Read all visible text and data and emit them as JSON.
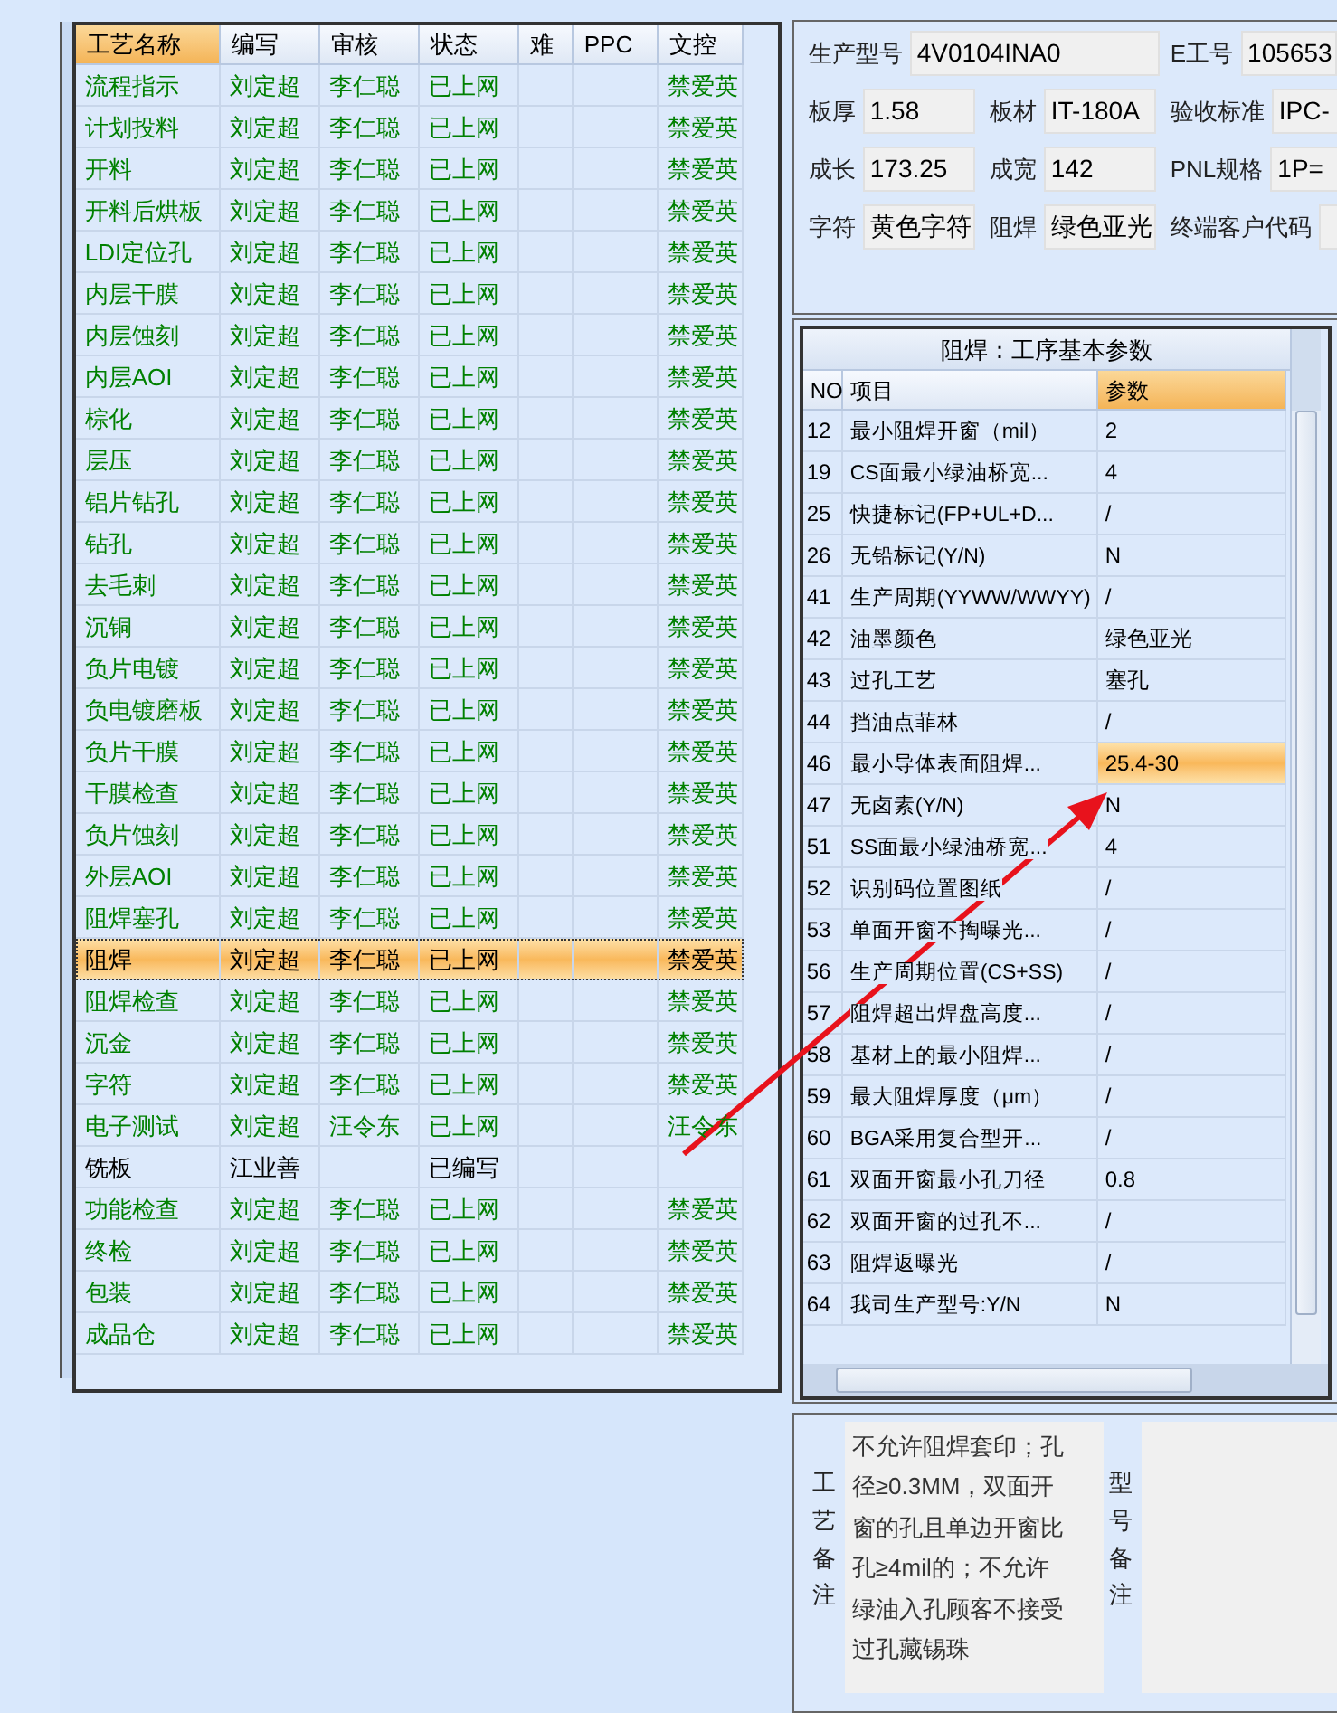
{
  "process_grid": {
    "columns": [
      {
        "label": "工艺名称",
        "sorted": true
      },
      {
        "label": "编写",
        "sorted": false
      },
      {
        "label": "审核",
        "sorted": false
      },
      {
        "label": "状态",
        "sorted": false
      },
      {
        "label": "难",
        "sorted": false
      },
      {
        "label": "PPC",
        "sorted": false
      },
      {
        "label": "文控",
        "sorted": false
      }
    ],
    "rows": [
      {
        "name": "流程指示",
        "writer": "刘定超",
        "reviewer": "李仁聪",
        "status": "已上网",
        "control": "禁爱英",
        "color": "#008000",
        "selected": false
      },
      {
        "name": "计划投料",
        "writer": "刘定超",
        "reviewer": "李仁聪",
        "status": "已上网",
        "control": "禁爱英",
        "color": "#008000",
        "selected": false
      },
      {
        "name": "开料",
        "writer": "刘定超",
        "reviewer": "李仁聪",
        "status": "已上网",
        "control": "禁爱英",
        "color": "#008000",
        "selected": false
      },
      {
        "name": "开料后烘板",
        "writer": "刘定超",
        "reviewer": "李仁聪",
        "status": "已上网",
        "control": "禁爱英",
        "color": "#008000",
        "selected": false
      },
      {
        "name": "LDI定位孔",
        "writer": "刘定超",
        "reviewer": "李仁聪",
        "status": "已上网",
        "control": "禁爱英",
        "color": "#008000",
        "selected": false
      },
      {
        "name": "内层干膜",
        "writer": "刘定超",
        "reviewer": "李仁聪",
        "status": "已上网",
        "control": "禁爱英",
        "color": "#008000",
        "selected": false
      },
      {
        "name": "内层蚀刻",
        "writer": "刘定超",
        "reviewer": "李仁聪",
        "status": "已上网",
        "control": "禁爱英",
        "color": "#008000",
        "selected": false
      },
      {
        "name": "内层AOI",
        "writer": "刘定超",
        "reviewer": "李仁聪",
        "status": "已上网",
        "control": "禁爱英",
        "color": "#008000",
        "selected": false
      },
      {
        "name": "棕化",
        "writer": "刘定超",
        "reviewer": "李仁聪",
        "status": "已上网",
        "control": "禁爱英",
        "color": "#008000",
        "selected": false
      },
      {
        "name": "层压",
        "writer": "刘定超",
        "reviewer": "李仁聪",
        "status": "已上网",
        "control": "禁爱英",
        "color": "#008000",
        "selected": false
      },
      {
        "name": "铝片钻孔",
        "writer": "刘定超",
        "reviewer": "李仁聪",
        "status": "已上网",
        "control": "禁爱英",
        "color": "#008000",
        "selected": false
      },
      {
        "name": "钻孔",
        "writer": "刘定超",
        "reviewer": "李仁聪",
        "status": "已上网",
        "control": "禁爱英",
        "color": "#008000",
        "selected": false
      },
      {
        "name": "去毛刺",
        "writer": "刘定超",
        "reviewer": "李仁聪",
        "status": "已上网",
        "control": "禁爱英",
        "color": "#008000",
        "selected": false
      },
      {
        "name": "沉铜",
        "writer": "刘定超",
        "reviewer": "李仁聪",
        "status": "已上网",
        "control": "禁爱英",
        "color": "#008000",
        "selected": false
      },
      {
        "name": "负片电镀",
        "writer": "刘定超",
        "reviewer": "李仁聪",
        "status": "已上网",
        "control": "禁爱英",
        "color": "#008000",
        "selected": false
      },
      {
        "name": "负电镀磨板",
        "writer": "刘定超",
        "reviewer": "李仁聪",
        "status": "已上网",
        "control": "禁爱英",
        "color": "#008000",
        "selected": false
      },
      {
        "name": "负片干膜",
        "writer": "刘定超",
        "reviewer": "李仁聪",
        "status": "已上网",
        "control": "禁爱英",
        "color": "#008000",
        "selected": false
      },
      {
        "name": "干膜检查",
        "writer": "刘定超",
        "reviewer": "李仁聪",
        "status": "已上网",
        "control": "禁爱英",
        "color": "#008000",
        "selected": false
      },
      {
        "name": "负片蚀刻",
        "writer": "刘定超",
        "reviewer": "李仁聪",
        "status": "已上网",
        "control": "禁爱英",
        "color": "#008000",
        "selected": false
      },
      {
        "name": "外层AOI",
        "writer": "刘定超",
        "reviewer": "李仁聪",
        "status": "已上网",
        "control": "禁爱英",
        "color": "#008000",
        "selected": false
      },
      {
        "name": "阻焊塞孔",
        "writer": "刘定超",
        "reviewer": "李仁聪",
        "status": "已上网",
        "control": "禁爱英",
        "color": "#008000",
        "selected": false
      },
      {
        "name": "阻焊",
        "writer": "刘定超",
        "reviewer": "李仁聪",
        "status": "已上网",
        "control": "禁爱英",
        "color": "#000000",
        "selected": true
      },
      {
        "name": "阻焊检查",
        "writer": "刘定超",
        "reviewer": "李仁聪",
        "status": "已上网",
        "control": "禁爱英",
        "color": "#008000",
        "selected": false
      },
      {
        "name": "沉金",
        "writer": "刘定超",
        "reviewer": "李仁聪",
        "status": "已上网",
        "control": "禁爱英",
        "color": "#008000",
        "selected": false
      },
      {
        "name": "字符",
        "writer": "刘定超",
        "reviewer": "李仁聪",
        "status": "已上网",
        "control": "禁爱英",
        "color": "#008000",
        "selected": false
      },
      {
        "name": "电子测试",
        "writer": "刘定超",
        "reviewer": "汪令东",
        "status": "已上网",
        "control": "汪令东",
        "color": "#008000",
        "selected": false
      },
      {
        "name": "铣板",
        "writer": "江业善",
        "status": "已编写",
        "color": "#000000",
        "selected": false
      },
      {
        "name": "功能检查",
        "writer": "刘定超",
        "reviewer": "李仁聪",
        "status": "已上网",
        "control": "禁爱英",
        "color": "#008000",
        "selected": false
      },
      {
        "name": "终检",
        "writer": "刘定超",
        "reviewer": "李仁聪",
        "status": "已上网",
        "control": "禁爱英",
        "color": "#008000",
        "selected": false
      },
      {
        "name": "包装",
        "writer": "刘定超",
        "reviewer": "李仁聪",
        "status": "已上网",
        "control": "禁爱英",
        "color": "#008000",
        "selected": false
      },
      {
        "name": "成品仓",
        "writer": "刘定超",
        "reviewer": "李仁聪",
        "status": "已上网",
        "control": "禁爱英",
        "color": "#008000",
        "selected": false
      }
    ]
  },
  "info": {
    "fields": [
      {
        "label": "生产型号",
        "value": "4V0104INA0"
      },
      {
        "label": "E工号",
        "value": "105653"
      },
      {
        "label": "板厚",
        "value": "1.58"
      },
      {
        "label": "板材",
        "value": "IT-180A"
      },
      {
        "label": "验收标准",
        "value": "IPC-"
      },
      {
        "label": "成长",
        "value": "173.25"
      },
      {
        "label": "成宽",
        "value": "142"
      },
      {
        "label": "PNL规格",
        "value": "1P="
      },
      {
        "label": "字符",
        "value": "黄色字符"
      },
      {
        "label": "阻焊",
        "value": "绿色亚光"
      },
      {
        "label": "终端客户代码"
      }
    ]
  },
  "params": {
    "title": "阻焊：工序基本参数",
    "columns": [
      {
        "label": "NO",
        "sorted": false
      },
      {
        "label": "项目",
        "sorted": false
      },
      {
        "label": "参数",
        "sorted": true
      }
    ],
    "rows": [
      {
        "no": "12",
        "item": "最小阻焊开窗（mil）",
        "value": "2",
        "selected": false
      },
      {
        "no": "19",
        "item": "CS面最小绿油桥宽...",
        "value": "4",
        "selected": false
      },
      {
        "no": "25",
        "item": "快捷标记(FP+UL+D...",
        "value": "/",
        "selected": false
      },
      {
        "no": "26",
        "item": "无铅标记(Y/N)",
        "value": "N",
        "selected": false
      },
      {
        "no": "41",
        "item": "生产周期(YYWW/WWYY)",
        "value": "/",
        "selected": false
      },
      {
        "no": "42",
        "item": "油墨颜色",
        "value": "绿色亚光",
        "selected": false
      },
      {
        "no": "43",
        "item": "过孔工艺",
        "value": "塞孔",
        "selected": false
      },
      {
        "no": "44",
        "item": "挡油点菲林",
        "value": "/",
        "selected": false
      },
      {
        "no": "46",
        "item": "最小导体表面阻焊...",
        "value": "25.4-30",
        "selected": true
      },
      {
        "no": "47",
        "item": "无卤素(Y/N)",
        "value": "N",
        "selected": false
      },
      {
        "no": "51",
        "item": "SS面最小绿油桥宽...",
        "value": "4",
        "selected": false
      },
      {
        "no": "52",
        "item": "识别码位置图纸",
        "value": "/",
        "selected": false
      },
      {
        "no": "53",
        "item": "单面开窗不掏曝光...",
        "value": "/",
        "selected": false
      },
      {
        "no": "56",
        "item": "生产周期位置(CS+SS)",
        "value": "/",
        "selected": false
      },
      {
        "no": "57",
        "item": "阻焊超出焊盘高度...",
        "value": "/",
        "selected": false
      },
      {
        "no": "58",
        "item": "基材上的最小阻焊...",
        "value": "/",
        "selected": false
      },
      {
        "no": "59",
        "item": "最大阻焊厚度（μm）",
        "value": "/",
        "selected": false
      },
      {
        "no": "60",
        "item": "BGA采用复合型开...",
        "value": "/",
        "selected": false
      },
      {
        "no": "61",
        "item": "双面开窗最小孔刀径",
        "value": "0.8",
        "selected": false
      },
      {
        "no": "62",
        "item": "双面开窗的过孔不...",
        "value": "/",
        "selected": false
      },
      {
        "no": "63",
        "item": "阻焊返曝光",
        "value": "/",
        "selected": false
      },
      {
        "no": "64",
        "item": "我司生产型号:Y/N",
        "value": "N",
        "selected": false
      }
    ]
  },
  "notes": [
    {
      "label": "工艺备注",
      "text": "不允许阻焊套印；孔径≥0.3MM，双面开窗的孔且单边开窗比孔≥4mil的；不允许绿油入孔顾客不接受过孔藏锡珠"
    },
    {
      "label": "型号备注"
    }
  ]
}
